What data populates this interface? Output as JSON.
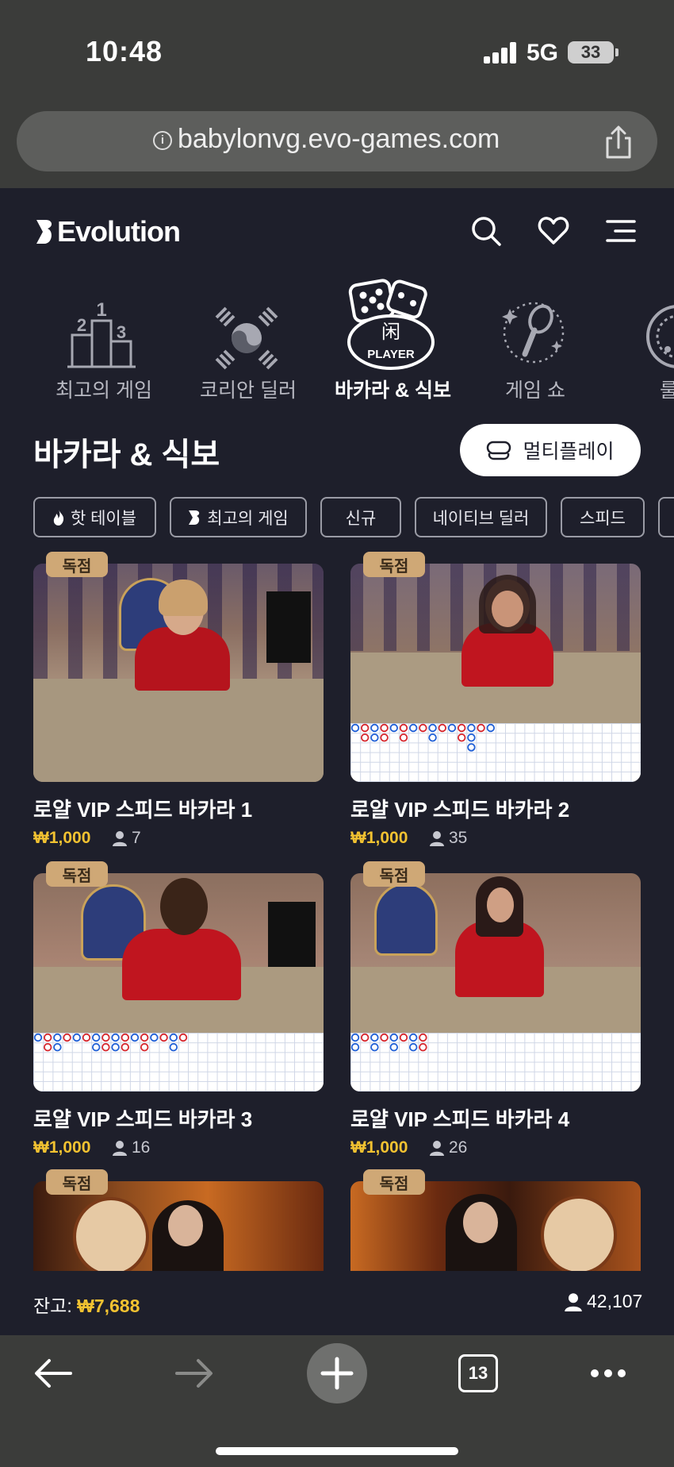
{
  "status": {
    "time": "10:48",
    "network": "5G",
    "battery": "33"
  },
  "browser": {
    "url": "babylonvg.evo-games.com",
    "tabs_count": "13"
  },
  "header": {
    "brand": "Evolution"
  },
  "categories": [
    {
      "label": "최고의 게임",
      "active": false
    },
    {
      "label": "코리안 딜러",
      "active": false
    },
    {
      "label": "바카라 & 식보",
      "active": true
    },
    {
      "label": "게임 쇼",
      "active": false
    },
    {
      "label": "룰",
      "active": false
    }
  ],
  "category_icon_text": {
    "player": "PLAYER",
    "podium_1": "1",
    "podium_2": "2",
    "podium_3": "3"
  },
  "section": {
    "title": "바카라 & 식보",
    "multiplay_label": "멀티플레이"
  },
  "filters": [
    {
      "label": "핫 테이블",
      "icon": "flame-icon"
    },
    {
      "label": "최고의 게임",
      "icon": "evolution-icon"
    },
    {
      "label": "신규"
    },
    {
      "label": "네이티브 딜러"
    },
    {
      "label": "스피드"
    }
  ],
  "games": [
    {
      "badge": "독점",
      "title": "로얄 VIP 스피드 바카라 1",
      "min_bet": "₩1,000",
      "players": "7"
    },
    {
      "badge": "독점",
      "title": "로얄 VIP 스피드 바카라 2",
      "min_bet": "₩1,000",
      "players": "35"
    },
    {
      "badge": "독점",
      "title": "로얄 VIP 스피드 바카라 3",
      "min_bet": "₩1,000",
      "players": "16"
    },
    {
      "badge": "독점",
      "title": "로얄 VIP 스피드 바카라 4",
      "min_bet": "₩1,000",
      "players": "26"
    },
    {
      "badge": "독점"
    },
    {
      "badge": "독점"
    }
  ],
  "footer": {
    "balance_label": "잔고:",
    "balance_value": "₩7,688",
    "online_count": "42,107"
  },
  "colors": {
    "background": "#1e1f2b",
    "gold": "#f2c231",
    "badge": "#cfa876",
    "chrome": "#3b3c3a"
  }
}
